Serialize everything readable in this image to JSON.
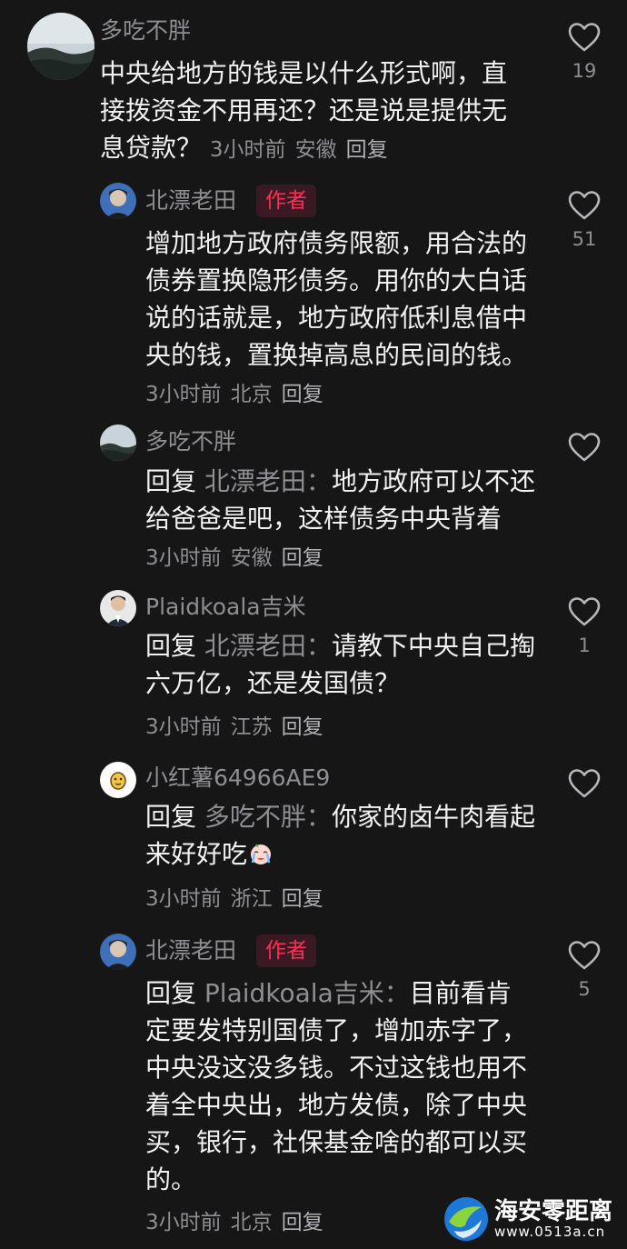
{
  "comments": [
    {
      "username": "多吃不胖",
      "text": "中央给地方的钱是以什么形式啊，直接拨资金不用再还？还是说是提供无息贷款？",
      "time": "3小时前",
      "location": "安徽",
      "reply_label": "回复",
      "likes": "19"
    },
    {
      "username": "北漂老田",
      "author_tag": "作者",
      "text": "增加地方政府债务限额，用合法的债券置换隐形债务。用你的大白话说的话就是，地方政府低利息借中央的钱，置换掉高息的民间的钱。",
      "time": "3小时前",
      "location": "北京",
      "reply_label": "回复",
      "likes": "51"
    },
    {
      "username": "多吃不胖",
      "reply_prefix": "回复",
      "reply_target": "北漂老田：",
      "text": "地方政府可以不还给爸爸是吧，这样债务中央背着",
      "time": "3小时前",
      "location": "安徽",
      "reply_label": "回复",
      "likes": ""
    },
    {
      "username": "Plaidkoala吉米",
      "reply_prefix": "回复",
      "reply_target": "北漂老田：",
      "text": "请教下中央自己掏六万亿，还是发国债？",
      "time": "3小时前",
      "location": "江苏",
      "reply_label": "回复",
      "likes": "1"
    },
    {
      "username": "小红薯64966AE9",
      "reply_prefix": "回复",
      "reply_target": "多吃不胖：",
      "text": "你家的卤牛肉看起来好好吃",
      "time": "3小时前",
      "location": "浙江",
      "reply_label": "回复",
      "likes": ""
    },
    {
      "username": "北漂老田",
      "author_tag": "作者",
      "reply_prefix": "回复",
      "reply_target": "Plaidkoala吉米：",
      "text": "目前看肯定要发特别国债了，增加赤字了，中央没这没多钱。不过这钱也用不着全中央出，地方发债，除了中央买，银行，社保基金啥的都可以买的。",
      "time": "3小时前",
      "location": "北京",
      "reply_label": "回复",
      "likes": "5"
    }
  ],
  "watermark": {
    "title": "海安零距离",
    "subtitle": "www.0513a.cn"
  },
  "colors": {
    "background": "#161617",
    "author_tag": "#ff2d55",
    "muted_text": "#8e8e93"
  }
}
